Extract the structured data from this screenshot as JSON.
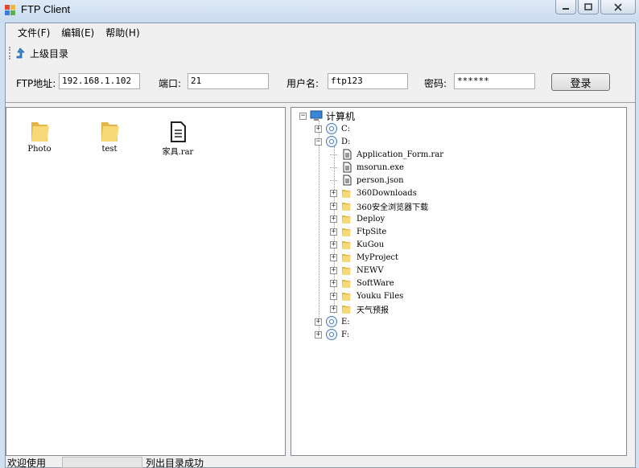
{
  "window": {
    "title": "FTP Client",
    "icon": "app-icon",
    "buttons": [
      "minimize-icon",
      "maximize-icon",
      "close-icon"
    ]
  },
  "menu": [
    {
      "label": "文件(F)"
    },
    {
      "label": "编辑(E)"
    },
    {
      "label": "帮助(H)"
    }
  ],
  "toolbar": {
    "up_label": "上级目录",
    "up_icon": "up-arrow-icon"
  },
  "connection": {
    "host_label": "FTP地址:",
    "host_value": "192.168.1.102",
    "port_label": "端口:",
    "port_value": "21",
    "user_label": "用户名:",
    "user_value": "ftp123",
    "pass_label": "密码:",
    "pass_value": "******",
    "login_label": "登录"
  },
  "remote_files": [
    {
      "name": "Photo",
      "icon": "folder-icon"
    },
    {
      "name": "test",
      "icon": "folder-icon"
    },
    {
      "name": "家具.rar",
      "icon": "file-icon"
    }
  ],
  "tree": {
    "root": "计算机",
    "nodes": [
      {
        "label": "C:",
        "icon": "drive-icon",
        "expander": "+"
      },
      {
        "label": "D:",
        "icon": "drive-icon",
        "expander": "-"
      },
      {
        "label": "Application_Form.rar",
        "icon": "file-icon"
      },
      {
        "label": "msorun.exe",
        "icon": "file-icon"
      },
      {
        "label": "person.json",
        "icon": "file-icon"
      },
      {
        "label": "360Downloads",
        "icon": "folder-icon",
        "expander": "+"
      },
      {
        "label": "360安全浏览器下载",
        "icon": "folder-icon",
        "expander": "+"
      },
      {
        "label": "Deploy",
        "icon": "folder-icon",
        "expander": "+"
      },
      {
        "label": "FtpSite",
        "icon": "folder-icon",
        "expander": "+"
      },
      {
        "label": "KuGou",
        "icon": "folder-icon",
        "expander": "+"
      },
      {
        "label": "MyProject",
        "icon": "folder-icon",
        "expander": "+"
      },
      {
        "label": "NEWV",
        "icon": "folder-icon",
        "expander": "+"
      },
      {
        "label": "SoftWare",
        "icon": "folder-icon",
        "expander": "+"
      },
      {
        "label": "Youku Files",
        "icon": "folder-icon",
        "expander": "+"
      },
      {
        "label": "天气预报",
        "icon": "folder-icon",
        "expander": "+"
      },
      {
        "label": "E:",
        "icon": "drive-icon",
        "expander": "+"
      },
      {
        "label": "F:",
        "icon": "drive-icon",
        "expander": "+"
      }
    ]
  },
  "status": {
    "welcome": "欢迎使用",
    "progress": 0,
    "message": "列出目录成功"
  }
}
